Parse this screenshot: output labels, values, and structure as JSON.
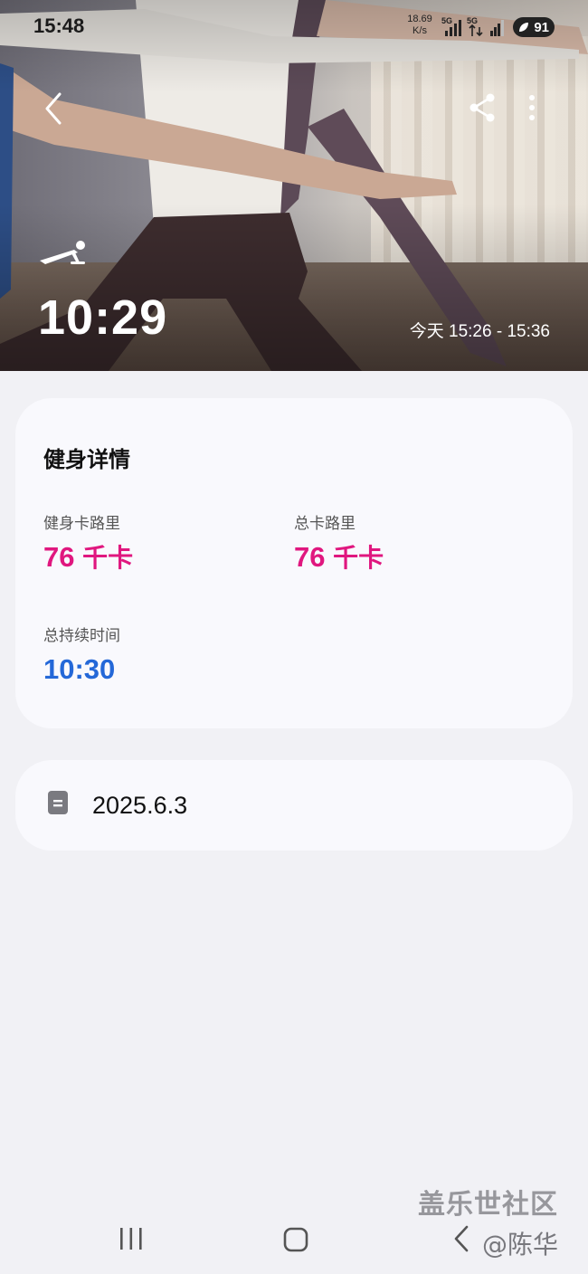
{
  "status_bar": {
    "time": "15:48",
    "net_speed_value": "18.69",
    "net_speed_unit": "K/s",
    "sim1_label": "5G",
    "sim2_label": "5G",
    "battery": "91"
  },
  "hero": {
    "duration": "10:29",
    "time_range": "今天 15:26 - 15:36"
  },
  "details": {
    "title": "健身详情",
    "workout_calories_label": "健身卡路里",
    "workout_calories_value": "76",
    "workout_calories_unit": "千卡",
    "total_calories_label": "总卡路里",
    "total_calories_value": "76",
    "total_calories_unit": "千卡",
    "total_duration_label": "总持续时间",
    "total_duration_value": "10:30"
  },
  "note": {
    "text": "2025.6.3"
  },
  "watermark": {
    "site": "盖乐世社区",
    "user": "@陈华"
  },
  "colors": {
    "calories": "#e0177f",
    "duration": "#2468d8",
    "card_bg": "#f9f9fd",
    "page_bg": "#f1f1f5"
  },
  "icons": {
    "back": "chevron-left-icon",
    "share": "share-icon",
    "more": "more-vertical-icon",
    "workout": "pushup-icon",
    "note": "note-icon"
  }
}
